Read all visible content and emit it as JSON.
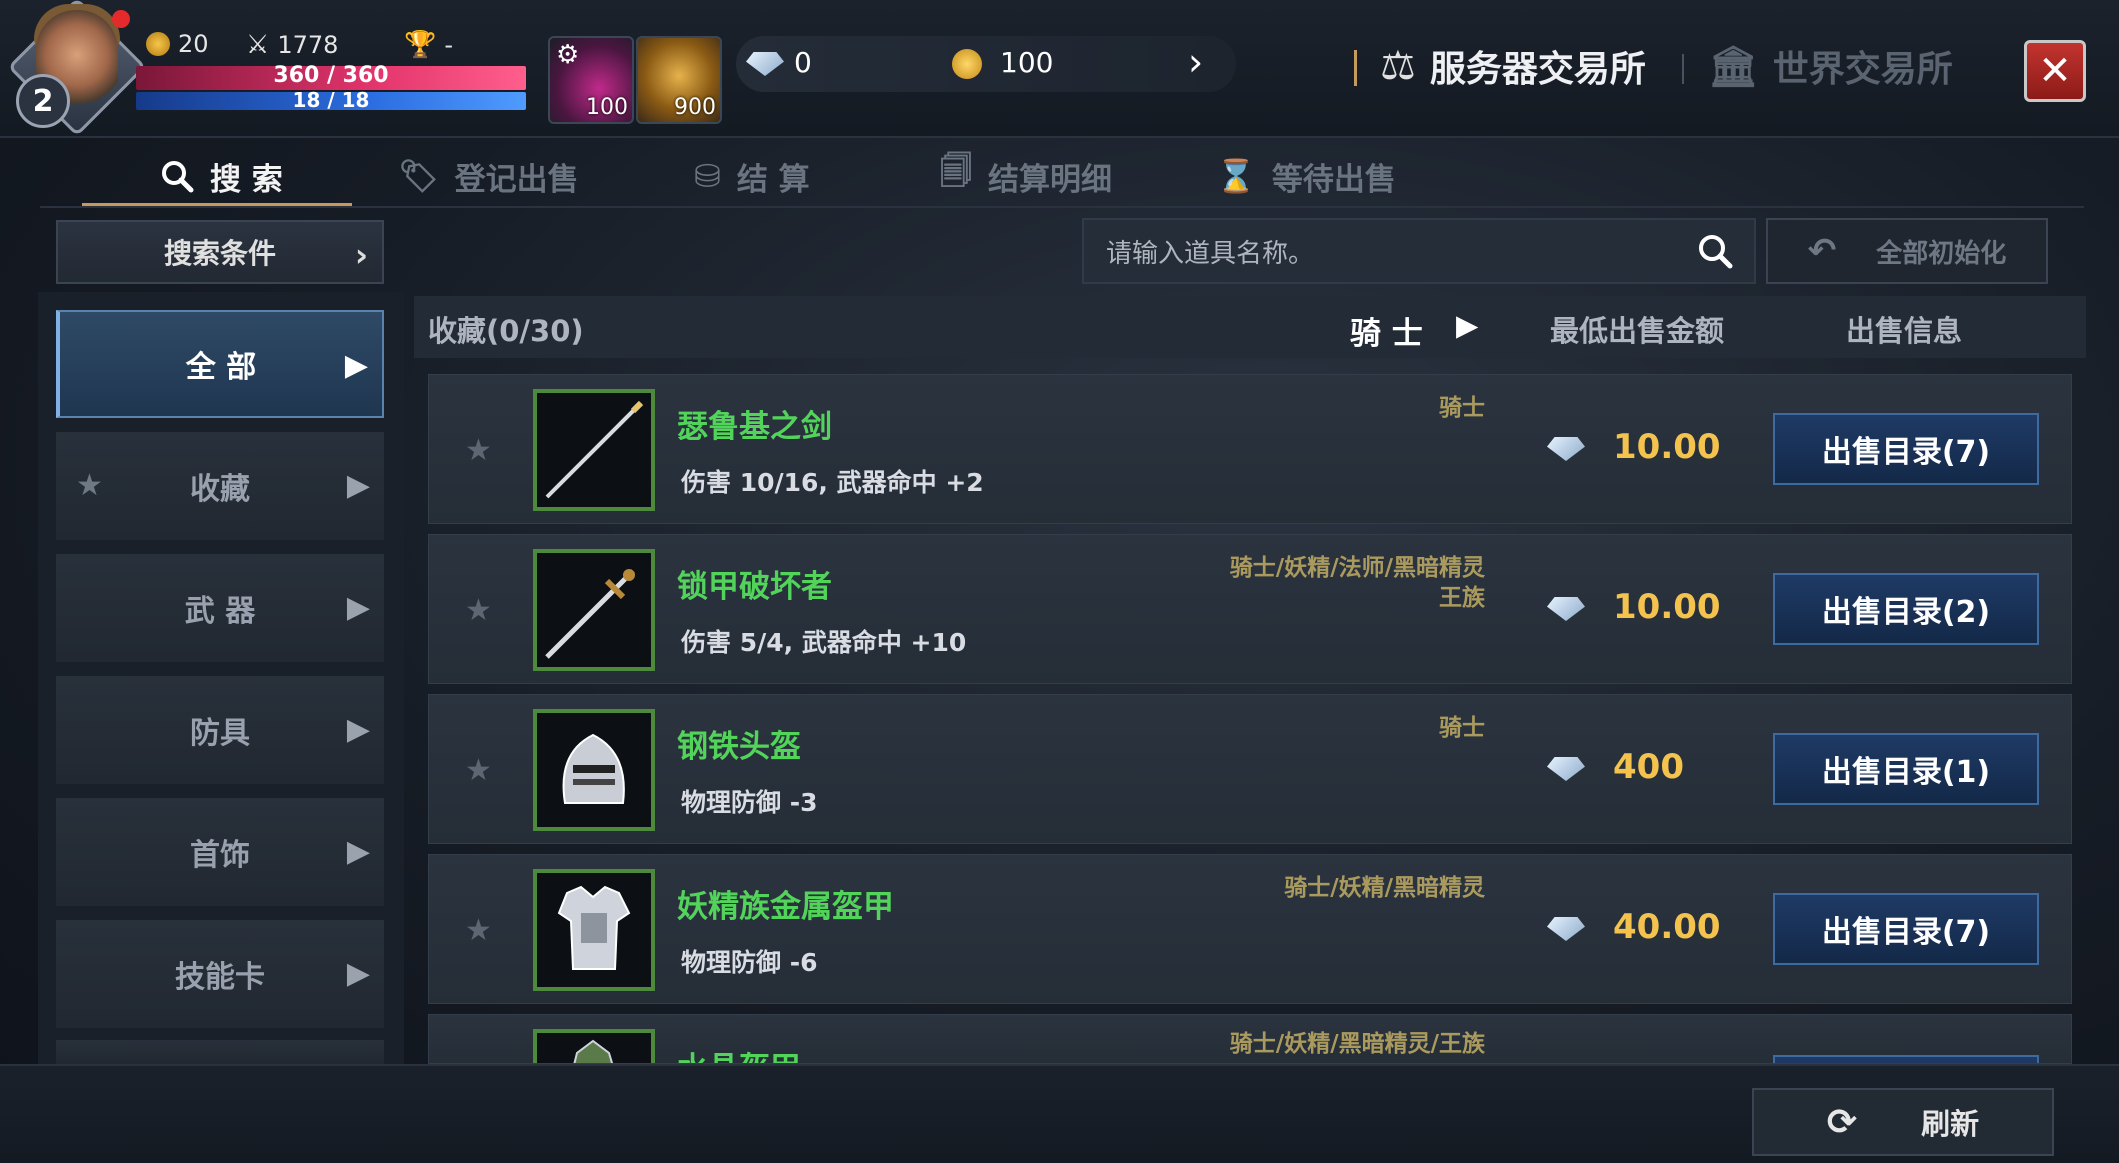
{
  "player": {
    "level": "2",
    "currency_a": "20",
    "combat_power": "1778",
    "rank": "-",
    "hp": "360 / 360",
    "mp": "18 / 18"
  },
  "quick_slots": [
    {
      "label": "100"
    },
    {
      "label": "900"
    }
  ],
  "currency": {
    "diamond": "0",
    "gold": "100"
  },
  "exchange_tabs": [
    {
      "label": "服务器交易所",
      "active": true
    },
    {
      "label": "世界交易所",
      "active": false
    }
  ],
  "sub_tabs": [
    {
      "label": "搜 索",
      "icon": "search-icon"
    },
    {
      "label": "登记出售",
      "icon": "tag-icon"
    },
    {
      "label": "结 算",
      "icon": "coins-icon"
    },
    {
      "label": "结算明细",
      "icon": "receipt-icon"
    },
    {
      "label": "等待出售",
      "icon": "hourglass-icon"
    }
  ],
  "search": {
    "conditions_label": "搜索条件",
    "placeholder": "请输入道具名称。",
    "reset_label": "全部初始化"
  },
  "sidebar": {
    "items": [
      {
        "label": "全 部"
      },
      {
        "label": "收藏"
      },
      {
        "label": "武 器"
      },
      {
        "label": "防具"
      },
      {
        "label": "首饰"
      },
      {
        "label": "技能卡"
      }
    ]
  },
  "list": {
    "favorites": "收藏(0/30)",
    "class_filter": "骑 士",
    "col_price": "最低出售金额",
    "col_info": "出售信息",
    "items": [
      {
        "name": "瑟鲁基之剑",
        "desc": "伤害 10/16, 武器命中 +2",
        "classes": [
          "骑士"
        ],
        "price": "10.00",
        "sale": "出售目录(7)",
        "icon": "sword-icon"
      },
      {
        "name": "锁甲破坏者",
        "desc": "伤害 5/4, 武器命中 +10",
        "classes": [
          "骑士/妖精/法师/黑暗精灵",
          "王族"
        ],
        "price": "10.00",
        "sale": "出售目录(2)",
        "icon": "rapier-icon"
      },
      {
        "name": "钢铁头盔",
        "desc": "物理防御 -3",
        "classes": [
          "骑士"
        ],
        "price": "400",
        "sale": "出售目录(1)",
        "icon": "helmet-icon"
      },
      {
        "name": "妖精族金属盔甲",
        "desc": "物理防御 -6",
        "classes": [
          "骑士/妖精/黑暗精灵"
        ],
        "price": "40.00",
        "sale": "出售目录(7)",
        "icon": "armor-icon"
      },
      {
        "name": "水晶盔甲",
        "desc": "",
        "classes": [
          "骑士/妖精/黑暗精灵/王族"
        ],
        "price": "",
        "sale": "",
        "icon": "crystal-armor-icon"
      }
    ]
  },
  "footer": {
    "refresh_label": "刷新"
  }
}
